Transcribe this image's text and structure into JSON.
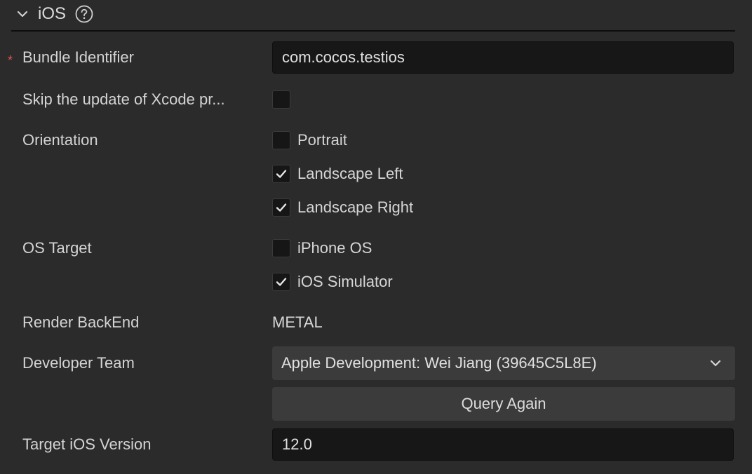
{
  "section": {
    "title": "iOS",
    "help_icon": "question-circle-icon",
    "collapse_icon": "chevron-down-icon"
  },
  "fields": {
    "bundle_identifier": {
      "label": "Bundle Identifier",
      "required_marker": "*",
      "value": "com.cocos.testios"
    },
    "skip_update": {
      "label": "Skip the update of Xcode pr...",
      "checked": false
    },
    "orientation": {
      "label": "Orientation",
      "options": [
        {
          "label": "Portrait",
          "checked": false
        },
        {
          "label": "Landscape Left",
          "checked": true
        },
        {
          "label": "Landscape Right",
          "checked": true
        }
      ]
    },
    "os_target": {
      "label": "OS Target",
      "options": [
        {
          "label": "iPhone OS",
          "checked": false
        },
        {
          "label": "iOS Simulator",
          "checked": true
        }
      ]
    },
    "render_backend": {
      "label": "Render BackEnd",
      "value": "METAL"
    },
    "developer_team": {
      "label": "Developer Team",
      "selected": "Apple Development: Wei Jiang (39645C5L8E)",
      "query_button": "Query Again"
    },
    "target_ios_version": {
      "label": "Target iOS Version",
      "value": "12.0"
    }
  },
  "colors": {
    "background": "#2b2b2b",
    "input_background": "#171717",
    "button_background": "#3b3b3b",
    "required": "#e05252",
    "text": "#d6d6d6"
  }
}
